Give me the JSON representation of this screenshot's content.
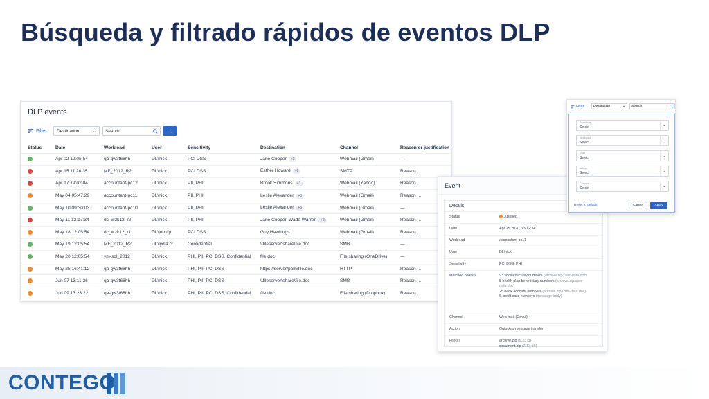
{
  "slide": {
    "title": "Búsqueda y filtrado rápidos de eventos DLP"
  },
  "events_panel": {
    "title": "DLP events",
    "filter_label": "Filter",
    "destination_select": "Destination",
    "search_placeholder": "Search",
    "go_arrow": "→",
    "columns": [
      "Status",
      "Date",
      "Workload",
      "User",
      "Sensitivity",
      "Destination",
      "Channel",
      "Reason or justification"
    ],
    "rows": [
      {
        "status": "green",
        "date": "Apr 02  12:05:54",
        "workload": "qa-gw3t68hh",
        "user": "DL\\nick",
        "sensitivity": "PCI DSS",
        "destination": "Jane Cooper",
        "chip": "+3",
        "channel": "Webmail (Gmail)",
        "reason": "—"
      },
      {
        "status": "red",
        "date": "Apr 15  11:26:35",
        "workload": "MF_2012_R2",
        "user": "DL\\nick",
        "sensitivity": "PCI DSS",
        "destination": "Esther Howard",
        "chip": "+1",
        "channel": "SMTP",
        "reason": "Reason ..."
      },
      {
        "status": "red",
        "date": "Apr 17  19:02:04",
        "workload": "accountant-pc12",
        "user": "DL\\nick",
        "sensitivity": "PII, PHI",
        "destination": "Brook Simmons",
        "chip": "+3",
        "channel": "Webmail (Yahoo)",
        "reason": "Reason ..."
      },
      {
        "status": "orange",
        "date": "May 04  05:47:29",
        "workload": "accountant-pc11",
        "user": "DL\\nick",
        "sensitivity": "PII, PHI",
        "destination": "Leslie Alexander",
        "chip": "+3",
        "channel": "Webmail (Gmail)",
        "reason": "Reason ..."
      },
      {
        "status": "green",
        "date": "May 10  09:30:03",
        "workload": "accountant-pc10",
        "user": "DL\\nick",
        "sensitivity": "PII, PHI",
        "destination": "Leslie Alexander",
        "chip": "+5",
        "channel": "Webmail (Gmail)",
        "reason": "—"
      },
      {
        "status": "red",
        "date": "May 11  12:17:34",
        "workload": "dc_w2k12_r2",
        "user": "DL\\nick",
        "sensitivity": "PII, PHI",
        "destination": "Jane Cooper, Wade Warren",
        "chip": "+3",
        "channel": "Webmail (Gmail)",
        "reason": "Reason ..."
      },
      {
        "status": "orange",
        "date": "May 18  12:05:54",
        "workload": "dc_w2k12_r1",
        "user": "DL\\john.p",
        "sensitivity": "PCI DSS",
        "destination": "Guy Hawkings",
        "chip": "",
        "channel": "Webmail (Gmail)",
        "reason": "Reason ..."
      },
      {
        "status": "green",
        "date": "May 19  12:05:54",
        "workload": "MF_2012_R2",
        "user": "DL\\lydia.cr",
        "sensitivity": "Confidential",
        "destination": "\\\\fileserver\\share\\file.doc",
        "chip": "",
        "channel": "SMB",
        "reason": "—"
      },
      {
        "status": "green",
        "date": "May 20  12:05:54",
        "workload": "vm-sql_2012",
        "user": "DL\\nick",
        "sensitivity": "PHI, PII, PCI DSS, Confidential",
        "destination": "file.doc",
        "chip": "",
        "channel": "File sharing (OneDrive)",
        "reason": "—"
      },
      {
        "status": "orange",
        "date": "May 25  16:41:12",
        "workload": "qa-gw3t68hh",
        "user": "DL\\nick",
        "sensitivity": "PHI, PII, PCI DSS",
        "destination": "https://server/path/file.doc",
        "chip": "",
        "channel": "HTTP",
        "reason": "Reason ..."
      },
      {
        "status": "orange",
        "date": "Jun 07  13:11:26",
        "workload": "qa-gw3t68hh",
        "user": "DL\\nick",
        "sensitivity": "PHI, PII, PCI DSS",
        "destination": "\\\\fileserver\\share\\file.doc",
        "chip": "",
        "channel": "SMB",
        "reason": "Reason ..."
      },
      {
        "status": "orange",
        "date": "Jun 09  13:23:22",
        "workload": "qa-gw3t68hh",
        "user": "DL\\nick",
        "sensitivity": "PHI, PII, PCI DSS, Confidential",
        "destination": "file.doc",
        "chip": "",
        "channel": "File sharing (Dropbox)",
        "reason": "Reason ..."
      }
    ]
  },
  "event_panel": {
    "title": "Event",
    "details_title": "Details",
    "status_label": "Status",
    "status_value": "Justified",
    "date_label": "Date",
    "date_value": "Apr 25 2020, 13:12:34",
    "workload_label": "Workload",
    "workload_value": "accountant-pc11",
    "user_label": "User",
    "user_value": "DL\\nick",
    "sensitivity_label": "Sensitivity",
    "sensitivity_value": "PCI DSS, PHI",
    "matched_label": "Matched content",
    "matched_lines": [
      {
        "main": "93 social security numbers",
        "lite": " (archive.zip/user-data.doc)"
      },
      {
        "main": "5 health plan beneficiary numbers",
        "lite": " (archive.zip/user-data.doc)"
      },
      {
        "main": "25 bank account numbers",
        "lite": " (archive.zip/user-data.doc)"
      },
      {
        "main": "6 credit card numbers",
        "lite": " (message body)"
      }
    ],
    "channel_label": "Channel",
    "channel_value": "Web mail (Gmail)",
    "action_label": "Action",
    "action_value": "Outgoing message transfer",
    "files_label": "File(s)",
    "file1": "archive.zip",
    "file1_size": "(5.33 kB)",
    "file2": "document.zip",
    "file2_size": "(2.13 kB)"
  },
  "filter_panel": {
    "filter_label": "Filter",
    "destination_select": "Destination",
    "search_placeholder": "Search",
    "fields": [
      {
        "label": "Sensitivity",
        "value": "Select"
      },
      {
        "label": "Workload",
        "value": "Select"
      },
      {
        "label": "User",
        "value": "Select"
      },
      {
        "label": "Action",
        "value": "Select"
      },
      {
        "label": "Channel",
        "value": "Select"
      }
    ],
    "reset_label": "Reset to default",
    "cancel_label": "Cancel",
    "apply_label": "Apply"
  },
  "footer": {
    "logo_text": "CONTEGO"
  },
  "colors": {
    "status_green": "#5cb85c",
    "status_red": "#d9413d",
    "status_orange": "#f0892b",
    "accent": "#2c66c6",
    "title": "#1b2f5a"
  }
}
